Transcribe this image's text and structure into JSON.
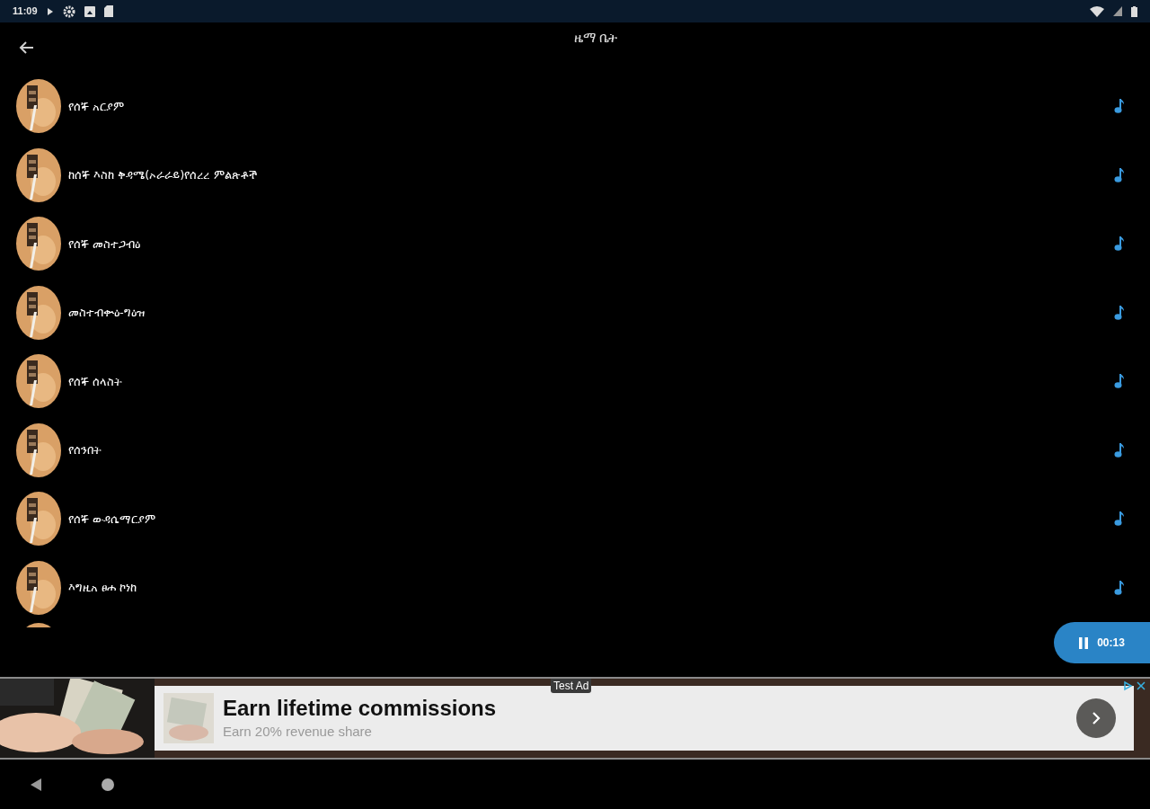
{
  "status_bar": {
    "time": "11:09"
  },
  "header": {
    "title": "ዜማ ቤት"
  },
  "songs": [
    {
      "title": "የሰኞ አርያም"
    },
    {
      "title": "ከሰኞ እስከ ቅዳሜ(ኦራራይ)የሰረረ ምልጽቶች"
    },
    {
      "title": "የሰኞ መስተጋብዕ"
    },
    {
      "title": "መስተብቍዕ-ግዕዝ"
    },
    {
      "title": "የሰኞ ሰላስት"
    },
    {
      "title": "የሰንበት"
    },
    {
      "title": "የሰኞ ውዳሴማርያም"
    },
    {
      "title": "እግዚአ ፀሐ ኮነከ"
    }
  ],
  "player": {
    "time": "00:13"
  },
  "ad": {
    "label": "Test Ad",
    "title": "Earn lifetime commissions",
    "subtitle": "Earn 20% revenue share"
  }
}
